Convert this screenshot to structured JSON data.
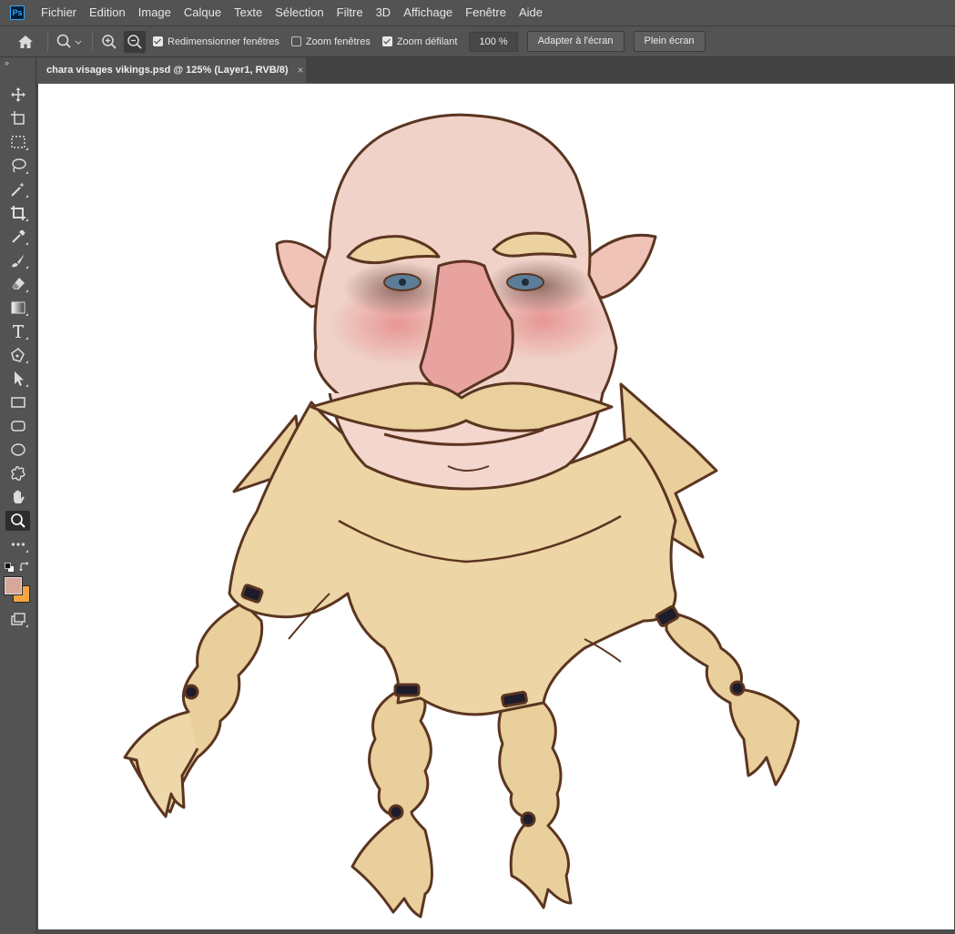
{
  "app": {
    "logo_text": "Ps"
  },
  "menu": [
    "Fichier",
    "Edition",
    "Image",
    "Calque",
    "Texte",
    "Sélection",
    "Filtre",
    "3D",
    "Affichage",
    "Fenêtre",
    "Aide"
  ],
  "options": {
    "resize_windows": {
      "label": "Redimensionner fenêtres",
      "checked": true
    },
    "zoom_all_windows": {
      "label": "Zoom fenêtres",
      "checked": false
    },
    "scrubby_zoom": {
      "label": "Zoom défilant",
      "checked": true
    },
    "zoom_value": "100 %",
    "fit_screen_label": "Adapter à l'écran",
    "fill_screen_label": "Plein écran"
  },
  "document": {
    "tab_title": "chara visages vikings.psd @ 125% (Layer1, RVB/8)",
    "close_glyph": "×"
  },
  "tools": [
    "move-tool",
    "artboard-tool",
    "marquee-tool",
    "lasso-tool",
    "magic-wand-tool",
    "crop-tool",
    "eyedropper-tool",
    "brush-tool",
    "eraser-tool",
    "gradient-tool",
    "type-tool",
    "pen-tool",
    "path-selection-tool",
    "rectangle-tool",
    "rounded-rectangle-tool",
    "ellipse-tool",
    "custom-shape-tool",
    "hand-tool",
    "zoom-tool",
    "more-tools"
  ],
  "colors": {
    "foreground": "#d7a79a",
    "background": "#f5a640",
    "ui_bg": "#535353",
    "canvas": "#ffffff"
  }
}
